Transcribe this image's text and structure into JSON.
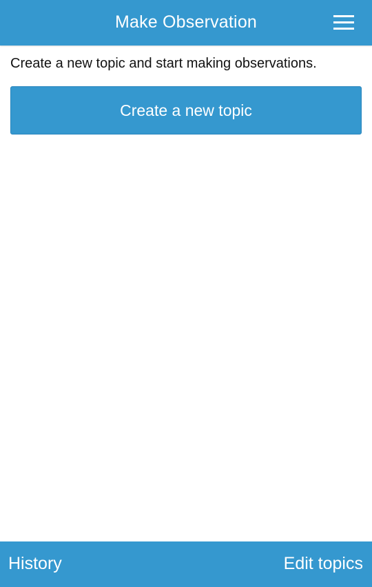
{
  "header": {
    "title": "Make Observation",
    "menu_icon": "hamburger-menu-icon"
  },
  "main": {
    "intro_text": "Create a new topic and start making observations.",
    "create_button_label": "Create a new topic"
  },
  "footer": {
    "history_label": "History",
    "edit_topics_label": "Edit topics"
  },
  "colors": {
    "primary": "#3598cf",
    "text": "#111111",
    "background": "#ffffff"
  }
}
